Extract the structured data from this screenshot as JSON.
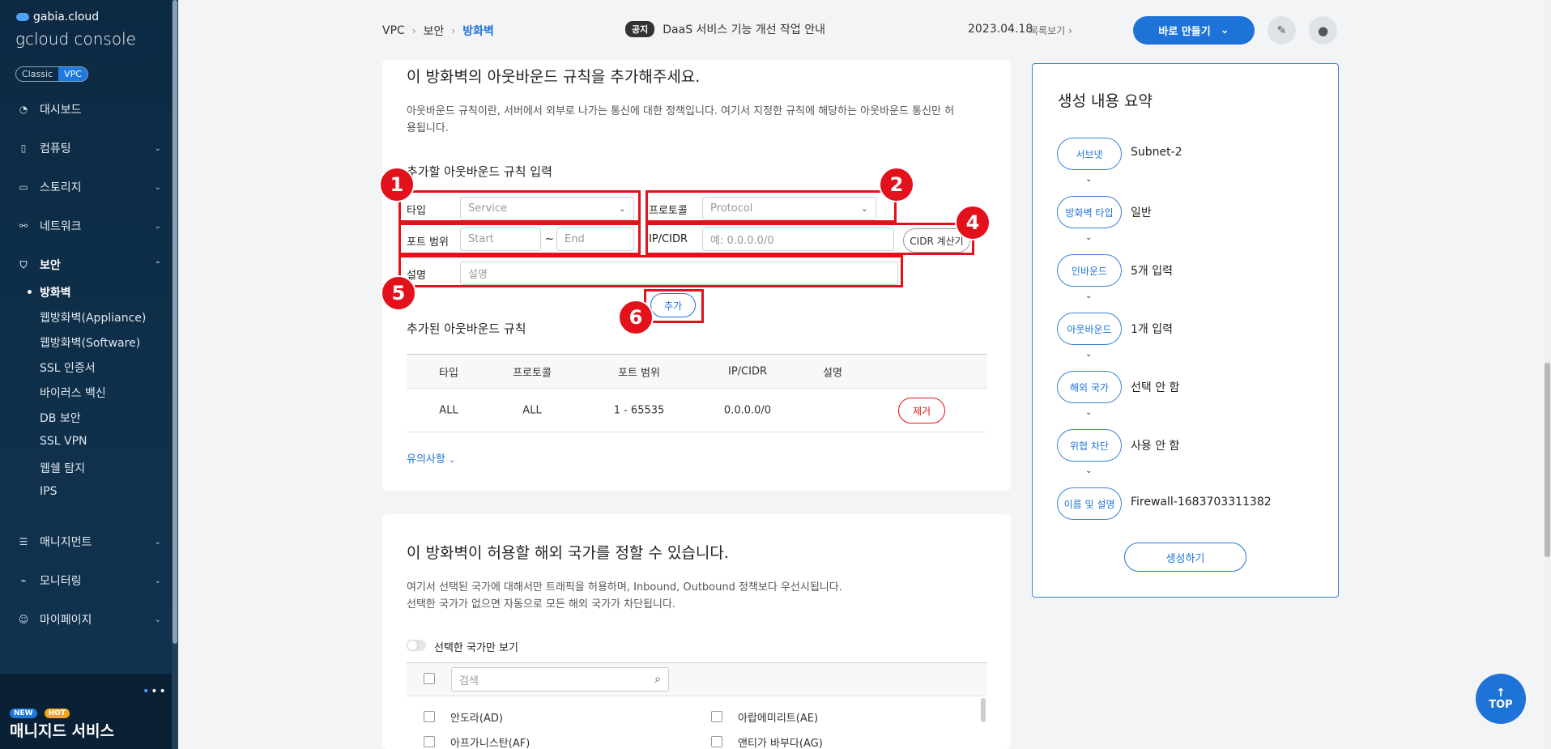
{
  "sidebar": {
    "brand": "gabia.cloud",
    "console_title": "gcloud console",
    "toggle": {
      "classic": "Classic",
      "vpc": "VPC"
    },
    "items": [
      {
        "label": "대시보드",
        "icon": "dashboard-icon"
      },
      {
        "label": "컴퓨팅",
        "icon": "server-icon"
      },
      {
        "label": "스토리지",
        "icon": "storage-icon"
      },
      {
        "label": "네트워크",
        "icon": "network-icon"
      },
      {
        "label": "보안",
        "icon": "shield-icon"
      },
      {
        "label": "매니지먼트",
        "icon": "management-icon"
      },
      {
        "label": "모니터링",
        "icon": "monitoring-icon"
      },
      {
        "label": "마이페이지",
        "icon": "user-icon"
      }
    ],
    "security_sub": [
      "방화벽",
      "웹방화벽(Appliance)",
      "웹방화벽(Software)",
      "SSL 인증서",
      "바이러스 백신",
      "DB 보안",
      "SSL VPN",
      "웹쉘 탐지",
      "IPS"
    ],
    "promo": {
      "new": "NEW",
      "hot": "HOT",
      "title": "매니지드 서비스"
    }
  },
  "header": {
    "breadcrumb": [
      "VPC",
      "보안",
      "방화벽"
    ],
    "notice_tag": "공지",
    "notice_text": "DaaS 서비스 기능 개선 작업 안내",
    "date": "2023.04.18",
    "list_link": "목록보기",
    "make_button": "바로 만들기"
  },
  "outbound": {
    "title": "이 방화벽의 아웃바운드 규칙을 추가해주세요.",
    "desc_1": "아웃바운드 규칙이란, 서버에서 외부로 나가는 통신에 대한 정책입니다. 여기서 지정한 규칙에 해당하는 아웃바운드 통신만 허",
    "desc_2": "용됩니다.",
    "input_title": "추가할 아웃바운드 규칙 입력",
    "type_label": "타입",
    "type_placeholder": "Service",
    "protocol_label": "프로토콜",
    "protocol_placeholder": "Protocol",
    "port_label": "포트 범위",
    "port_start": "Start",
    "port_end": "End",
    "tilde": "~",
    "ip_label": "IP/CIDR",
    "ip_placeholder": "예: 0.0.0.0/0",
    "cidr_button": "CIDR 계산기",
    "desc_label": "설명",
    "desc_placeholder": "설명",
    "add_button": "추가",
    "added_title": "추가된 아웃바운드 규칙",
    "columns": [
      "타입",
      "프로토콜",
      "포트 범위",
      "IP/CIDR",
      "설명"
    ],
    "rows": [
      {
        "type": "ALL",
        "protocol": "ALL",
        "port": "1 - 65535",
        "ip": "0.0.0.0/0",
        "desc": "",
        "remove": "제거"
      }
    ],
    "notes_link": "유의사항",
    "markers": [
      "1",
      "2",
      "4",
      "5",
      "6"
    ]
  },
  "country": {
    "title": "이 방화벽이 허용할 해외 국가를 정할 수 있습니다.",
    "desc_1": "여기서 선택된 국가에 대해서만 트래픽을 허용하며, Inbound, Outbound 정책보다 우선시됩니다.",
    "desc_2": "선택한 국가가 없으면 자동으로 모든 해외 국가가 차단됩니다.",
    "switch_label": "선택한 국가만 보기",
    "search_placeholder": "검색",
    "countries": [
      "안도라(AD)",
      "아랍에미리트(AE)",
      "아프가니스탄(AF)",
      "앤티가 바부다(AG)"
    ]
  },
  "summary": {
    "title": "생성 내용 요약",
    "steps": [
      {
        "label": "서브넷",
        "value": "Subnet-2"
      },
      {
        "label": "방화벽 타입",
        "value": "일반"
      },
      {
        "label": "인바운드",
        "value": "5개 입력"
      },
      {
        "label": "아웃바운드",
        "value": "1개 입력"
      },
      {
        "label": "해외 국가",
        "value": "선택 안 함"
      },
      {
        "label": "위협 차단",
        "value": "사용 안 함"
      },
      {
        "label": "이름 및 설명",
        "value": "Firewall-1683703311382"
      }
    ],
    "create_button": "생성하기"
  },
  "top_button": "TOP",
  "colors": {
    "accent": "#1e73d8",
    "annotation": "#e3111b",
    "sidebar": "#0d2a43"
  }
}
